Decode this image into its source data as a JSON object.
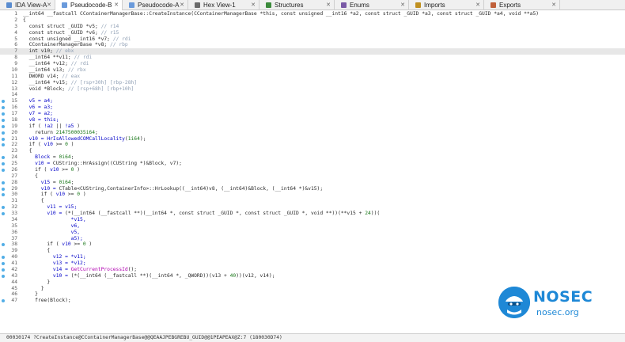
{
  "tabs": [
    {
      "label": "IDA View-A",
      "icon": "ida-view-icon",
      "active": false,
      "color": "#5a8ccf"
    },
    {
      "label": "Pseudocode-B",
      "icon": "pseudocode-icon",
      "active": true,
      "color": "#6a9adb"
    },
    {
      "label": "Pseudocode-A",
      "icon": "pseudocode-icon",
      "active": false,
      "color": "#6a9adb"
    },
    {
      "label": "Hex View-1",
      "icon": "hex-view-icon",
      "active": false,
      "color": "#6a6a6a"
    },
    {
      "label": "Structures",
      "icon": "structures-icon",
      "active": false,
      "color": "#3b8a3b"
    },
    {
      "label": "Enums",
      "icon": "enums-icon",
      "active": false,
      "color": "#7a5aa6"
    },
    {
      "label": "Imports",
      "icon": "imports-icon",
      "active": false,
      "color": "#c09020"
    },
    {
      "label": "Exports",
      "icon": "exports-icon",
      "active": false,
      "color": "#c0603a"
    }
  ],
  "close_glyph": "✕",
  "code_lines": [
    {
      "num": "1",
      "bp": false,
      "hl": false,
      "segs": [
        {
          "t": "__int64 __fastcall CContainerManagerBase::CreateInstance(CContainerManagerBase *this, const unsigned __int16 *a2, const struct _GUID *a3, const struct _GUID *a4, void **a5)",
          "c": ""
        }
      ]
    },
    {
      "num": "2",
      "bp": false,
      "hl": false,
      "segs": [
        {
          "t": "{",
          "c": ""
        }
      ]
    },
    {
      "num": "3",
      "bp": false,
      "hl": false,
      "segs": [
        {
          "t": "  const struct _GUID *v5; ",
          "c": ""
        },
        {
          "t": "// r14",
          "c": "cm"
        }
      ]
    },
    {
      "num": "4",
      "bp": false,
      "hl": false,
      "segs": [
        {
          "t": "  const struct _GUID *v6; ",
          "c": ""
        },
        {
          "t": "// r15",
          "c": "cm"
        }
      ]
    },
    {
      "num": "5",
      "bp": false,
      "hl": false,
      "segs": [
        {
          "t": "  const unsigned __int16 *v7; ",
          "c": ""
        },
        {
          "t": "// rdi",
          "c": "cm"
        }
      ]
    },
    {
      "num": "6",
      "bp": false,
      "hl": false,
      "segs": [
        {
          "t": "  CContainerManagerBase *v8; ",
          "c": ""
        },
        {
          "t": "// rbp",
          "c": "cm"
        }
      ]
    },
    {
      "num": "7",
      "bp": false,
      "hl": true,
      "segs": [
        {
          "t": "  int v10; ",
          "c": ""
        },
        {
          "t": "// ebx",
          "c": "cm"
        }
      ]
    },
    {
      "num": "8",
      "bp": false,
      "hl": false,
      "segs": [
        {
          "t": "  __int64 **v11; ",
          "c": ""
        },
        {
          "t": "// rdi",
          "c": "cm"
        }
      ]
    },
    {
      "num": "9",
      "bp": false,
      "hl": false,
      "segs": [
        {
          "t": "  __int64 *v12; ",
          "c": ""
        },
        {
          "t": "// rdi",
          "c": "cm"
        }
      ]
    },
    {
      "num": "10",
      "bp": false,
      "hl": false,
      "segs": [
        {
          "t": "  __int64 v13; ",
          "c": ""
        },
        {
          "t": "// rbx",
          "c": "cm"
        }
      ]
    },
    {
      "num": "11",
      "bp": false,
      "hl": false,
      "segs": [
        {
          "t": "  DWORD v14; ",
          "c": ""
        },
        {
          "t": "// eax",
          "c": "cm"
        }
      ]
    },
    {
      "num": "12",
      "bp": false,
      "hl": false,
      "segs": [
        {
          "t": "  __int64 *v15; ",
          "c": ""
        },
        {
          "t": "// [rsp+30h] [rbp-28h]",
          "c": "cm"
        }
      ]
    },
    {
      "num": "13",
      "bp": false,
      "hl": false,
      "segs": [
        {
          "t": "  void *Block; ",
          "c": ""
        },
        {
          "t": "// [rsp+68h] [rbp+10h]",
          "c": "cm"
        }
      ]
    },
    {
      "num": "14",
      "bp": false,
      "hl": false,
      "segs": [
        {
          "t": "",
          "c": ""
        }
      ]
    },
    {
      "num": "15",
      "bp": true,
      "hl": false,
      "segs": [
        {
          "t": "  v5 = a4;",
          "c": "var"
        }
      ]
    },
    {
      "num": "16",
      "bp": true,
      "hl": false,
      "segs": [
        {
          "t": "  v6 = a3;",
          "c": "var"
        }
      ]
    },
    {
      "num": "17",
      "bp": true,
      "hl": false,
      "segs": [
        {
          "t": "  v7 = a2;",
          "c": "var"
        }
      ]
    },
    {
      "num": "18",
      "bp": true,
      "hl": false,
      "segs": [
        {
          "t": "  v8 = this;",
          "c": "var"
        }
      ]
    },
    {
      "num": "19",
      "bp": true,
      "hl": false,
      "segs": [
        {
          "t": "  if ( ",
          "c": ""
        },
        {
          "t": "!a2",
          "c": "var"
        },
        {
          "t": " || ",
          "c": ""
        },
        {
          "t": "!a5",
          "c": "var"
        },
        {
          "t": " )",
          "c": ""
        }
      ]
    },
    {
      "num": "20",
      "bp": true,
      "hl": false,
      "segs": [
        {
          "t": "    return ",
          "c": ""
        },
        {
          "t": "2147500035i64",
          "c": "num"
        },
        {
          "t": ";",
          "c": ""
        }
      ]
    },
    {
      "num": "21",
      "bp": true,
      "hl": false,
      "segs": [
        {
          "t": "  v10 = ",
          "c": "var"
        },
        {
          "t": "HrIsAllowedCOMCallLocality",
          "c": "var"
        },
        {
          "t": "(",
          "c": ""
        },
        {
          "t": "1i64",
          "c": "num"
        },
        {
          "t": ");",
          "c": ""
        }
      ]
    },
    {
      "num": "22",
      "bp": true,
      "hl": false,
      "segs": [
        {
          "t": "  if ( ",
          "c": ""
        },
        {
          "t": "v10",
          "c": "var"
        },
        {
          "t": " >= ",
          "c": ""
        },
        {
          "t": "0",
          "c": "num"
        },
        {
          "t": " )",
          "c": ""
        }
      ]
    },
    {
      "num": "23",
      "bp": false,
      "hl": false,
      "segs": [
        {
          "t": "  {",
          "c": ""
        }
      ]
    },
    {
      "num": "24",
      "bp": true,
      "hl": false,
      "segs": [
        {
          "t": "    Block",
          "c": "var"
        },
        {
          "t": " = ",
          "c": ""
        },
        {
          "t": "0i64",
          "c": "num"
        },
        {
          "t": ";",
          "c": ""
        }
      ]
    },
    {
      "num": "25",
      "bp": true,
      "hl": false,
      "segs": [
        {
          "t": "    v10 = ",
          "c": "var"
        },
        {
          "t": "CUString::HrAssign((CUString *)&Block, v7);",
          "c": ""
        }
      ]
    },
    {
      "num": "26",
      "bp": true,
      "hl": false,
      "segs": [
        {
          "t": "    if ( ",
          "c": ""
        },
        {
          "t": "v10",
          "c": "var"
        },
        {
          "t": " >= ",
          "c": ""
        },
        {
          "t": "0",
          "c": "num"
        },
        {
          "t": " )",
          "c": ""
        }
      ]
    },
    {
      "num": "27",
      "bp": false,
      "hl": false,
      "segs": [
        {
          "t": "    {",
          "c": ""
        }
      ]
    },
    {
      "num": "28",
      "bp": true,
      "hl": false,
      "segs": [
        {
          "t": "      v15",
          "c": "var"
        },
        {
          "t": " = ",
          "c": ""
        },
        {
          "t": "0i64",
          "c": "num"
        },
        {
          "t": ";",
          "c": ""
        }
      ]
    },
    {
      "num": "29",
      "bp": true,
      "hl": false,
      "segs": [
        {
          "t": "      v10 = ",
          "c": "var"
        },
        {
          "t": "CTable<CUString,ContainerInfo>::HrLookup((__int64)v8, (__int64)&Block, (__int64 *)&v15);",
          "c": ""
        }
      ]
    },
    {
      "num": "30",
      "bp": true,
      "hl": false,
      "segs": [
        {
          "t": "      if ( ",
          "c": ""
        },
        {
          "t": "v10",
          "c": "var"
        },
        {
          "t": " >= ",
          "c": ""
        },
        {
          "t": "0",
          "c": "num"
        },
        {
          "t": " )",
          "c": ""
        }
      ]
    },
    {
      "num": "31",
      "bp": false,
      "hl": false,
      "segs": [
        {
          "t": "      {",
          "c": ""
        }
      ]
    },
    {
      "num": "32",
      "bp": true,
      "hl": false,
      "segs": [
        {
          "t": "        v11 = v15;",
          "c": "var"
        }
      ]
    },
    {
      "num": "33",
      "bp": true,
      "hl": false,
      "segs": [
        {
          "t": "        v10 = ",
          "c": "var"
        },
        {
          "t": "(*(__int64 (__fastcall **)(__int64 *, const struct _GUID *, const struct _GUID *, void **))(**v15 + ",
          "c": ""
        },
        {
          "t": "24",
          "c": "num"
        },
        {
          "t": "))(",
          "c": ""
        }
      ]
    },
    {
      "num": "34",
      "bp": false,
      "hl": false,
      "segs": [
        {
          "t": "                *v15,",
          "c": "var"
        }
      ]
    },
    {
      "num": "35",
      "bp": false,
      "hl": false,
      "segs": [
        {
          "t": "                v6,",
          "c": "var"
        }
      ]
    },
    {
      "num": "36",
      "bp": false,
      "hl": false,
      "segs": [
        {
          "t": "                v5,",
          "c": "var"
        }
      ]
    },
    {
      "num": "37",
      "bp": false,
      "hl": false,
      "segs": [
        {
          "t": "                a5);",
          "c": "var"
        }
      ]
    },
    {
      "num": "38",
      "bp": true,
      "hl": false,
      "segs": [
        {
          "t": "        if ( ",
          "c": ""
        },
        {
          "t": "v10",
          "c": "var"
        },
        {
          "t": " >= ",
          "c": ""
        },
        {
          "t": "0",
          "c": "num"
        },
        {
          "t": " )",
          "c": ""
        }
      ]
    },
    {
      "num": "39",
      "bp": false,
      "hl": false,
      "segs": [
        {
          "t": "        {",
          "c": ""
        }
      ]
    },
    {
      "num": "40",
      "bp": true,
      "hl": false,
      "segs": [
        {
          "t": "          v12 = *v11;",
          "c": "var"
        }
      ]
    },
    {
      "num": "41",
      "bp": true,
      "hl": false,
      "segs": [
        {
          "t": "          v13 = *v12;",
          "c": "var"
        }
      ]
    },
    {
      "num": "42",
      "bp": true,
      "hl": false,
      "segs": [
        {
          "t": "          v14 = ",
          "c": "var"
        },
        {
          "t": "GetCurrentProcessId",
          "c": "fn"
        },
        {
          "t": "();",
          "c": ""
        }
      ]
    },
    {
      "num": "43",
      "bp": true,
      "hl": false,
      "segs": [
        {
          "t": "          v10 = ",
          "c": "var"
        },
        {
          "t": "(*(__int64 (__fastcall **)(__int64 *, _QWORD))(v13 + ",
          "c": ""
        },
        {
          "t": "40",
          "c": "num"
        },
        {
          "t": "))(v12, v14);",
          "c": ""
        }
      ]
    },
    {
      "num": "44",
      "bp": false,
      "hl": false,
      "segs": [
        {
          "t": "        }",
          "c": ""
        }
      ]
    },
    {
      "num": "45",
      "bp": false,
      "hl": false,
      "segs": [
        {
          "t": "      }",
          "c": ""
        }
      ]
    },
    {
      "num": "46",
      "bp": false,
      "hl": false,
      "segs": [
        {
          "t": "    }",
          "c": ""
        }
      ]
    },
    {
      "num": "47",
      "bp": true,
      "hl": false,
      "segs": [
        {
          "t": "    free(Block);",
          "c": ""
        }
      ]
    }
  ],
  "watermark": {
    "title": "NOSEC",
    "subtitle": "nosec.org",
    "color": "#1e88d6"
  },
  "status_bar": {
    "text": "00030174 ?CreateInstance@CContainerManagerBase@@QEAAJPEBGREBU_GUID@@1PEAPEAX@Z:7 (180030D74)"
  }
}
